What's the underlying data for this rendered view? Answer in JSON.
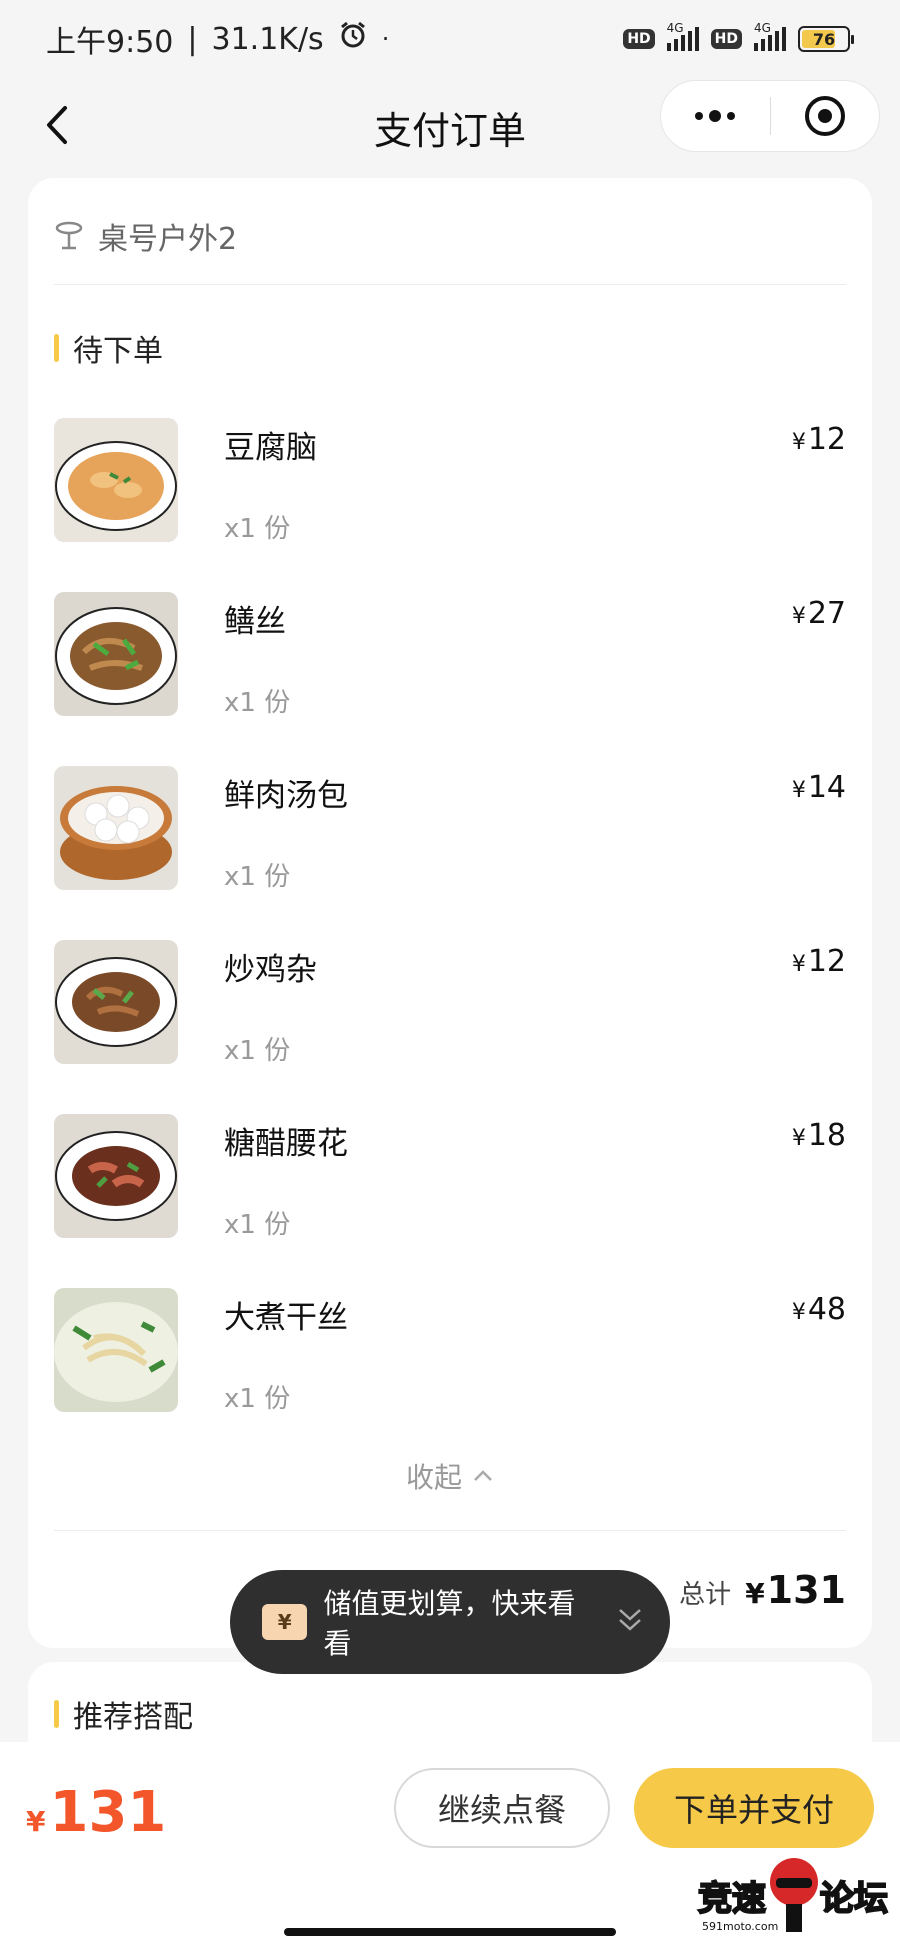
{
  "status_bar": {
    "time": "上午9:50",
    "speed": "31.1K/s",
    "dot": "·",
    "hd1": "HD",
    "net1": "4G",
    "hd2": "HD",
    "net2": "4G",
    "battery": "76"
  },
  "nav": {
    "title": "支付订单"
  },
  "order": {
    "table_label": "桌号户外2",
    "section_title": "待下单",
    "currency": "¥",
    "items": [
      {
        "name": "豆腐脑",
        "qty": "x1 份",
        "price": "12"
      },
      {
        "name": "鳝丝",
        "qty": "x1 份",
        "price": "27"
      },
      {
        "name": "鲜肉汤包",
        "qty": "x1 份",
        "price": "14"
      },
      {
        "name": "炒鸡杂",
        "qty": "x1 份",
        "price": "12"
      },
      {
        "name": "糖醋腰花",
        "qty": "x1 份",
        "price": "18"
      },
      {
        "name": "大煮干丝",
        "qty": "x1 份",
        "price": "48"
      }
    ],
    "collapse_label": "收起",
    "total_label": "总计",
    "total_value": "131"
  },
  "recommend": {
    "title": "推荐搭配"
  },
  "toast": {
    "text": "储值更划算，快来看看",
    "icon_glyph": "¥"
  },
  "bottom": {
    "currency": "¥",
    "price": "131",
    "continue_label": "继续点餐",
    "pay_label": "下单并支付"
  },
  "watermark": {
    "text": "竞速论坛",
    "sub": "591moto.com"
  },
  "colors": {
    "accent": "#f7c948",
    "price_red": "#f2562a",
    "toast_bg": "#2f2f2f"
  }
}
